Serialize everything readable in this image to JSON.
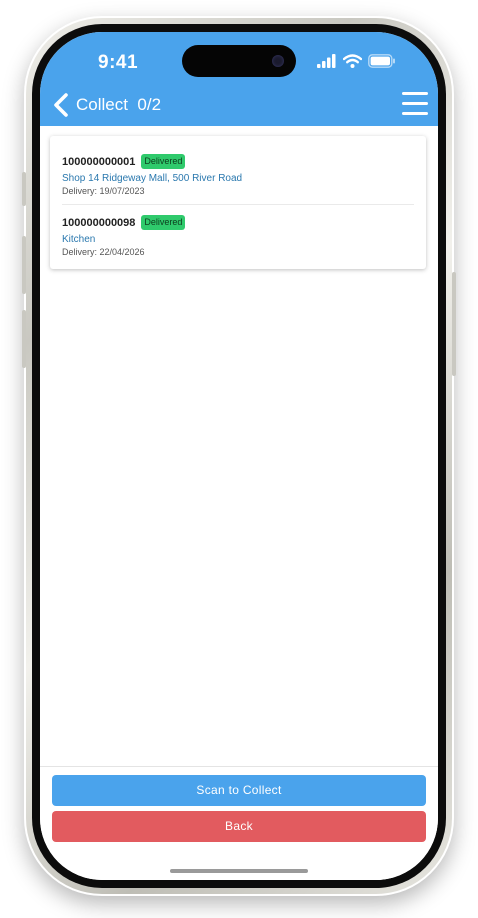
{
  "status_bar": {
    "time": "9:41"
  },
  "nav": {
    "title": "Collect",
    "count": "0/2"
  },
  "orders": [
    {
      "number": "100000000001",
      "status": "Delivered",
      "location": "Shop 14 Ridgeway Mall, 500 River Road",
      "delivery": "Delivery: 19/07/2023"
    },
    {
      "number": "100000000098",
      "status": "Delivered",
      "location": "Kitchen",
      "delivery": "Delivery: 22/04/2026"
    }
  ],
  "actions": {
    "scan_label": "Scan to Collect",
    "back_label": "Back"
  },
  "colors": {
    "primary": "#4aa3ec",
    "danger": "#e25b5f",
    "success": "#2fca6c",
    "link": "#2a78ae"
  }
}
